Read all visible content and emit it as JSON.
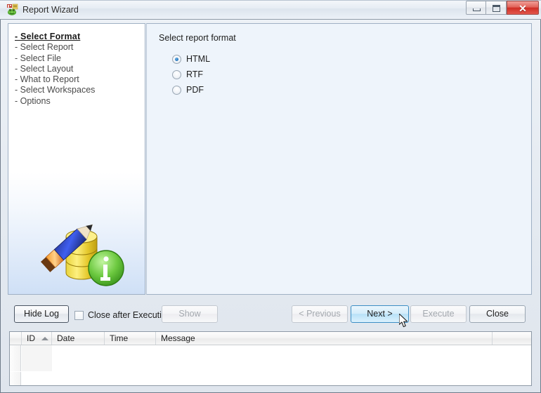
{
  "window": {
    "title": "Report Wizard",
    "icon": "report-wizard-icon",
    "controls": {
      "minimize": "–",
      "maximize": "□",
      "close": "✕"
    }
  },
  "sidebar": {
    "steps": [
      {
        "label": "- Select Format",
        "active": true
      },
      {
        "label": "- Select Report",
        "active": false
      },
      {
        "label": "- Select File",
        "active": false
      },
      {
        "label": "- Select Layout",
        "active": false
      },
      {
        "label": "- What to Report",
        "active": false
      },
      {
        "label": "- Select Workspaces",
        "active": false
      },
      {
        "label": "- Options",
        "active": false
      }
    ],
    "illustration": "pencil-database-info-illustration"
  },
  "content": {
    "title": "Select report format",
    "options": [
      {
        "label": "HTML",
        "selected": true
      },
      {
        "label": "RTF",
        "selected": false
      },
      {
        "label": "PDF",
        "selected": false
      }
    ]
  },
  "toolbar": {
    "hide_log_label": "Hide Log",
    "close_after_execution_label": "Close after Execution",
    "close_after_execution_checked": false,
    "show_label": "Show",
    "show_enabled": false,
    "previous_label": "< Previous",
    "previous_enabled": false,
    "next_label": "Next >",
    "next_enabled": true,
    "execute_label": "Execute",
    "execute_enabled": false,
    "close_label": "Close",
    "close_enabled": true
  },
  "log": {
    "columns": [
      {
        "label": "ID",
        "sorted": "ascending"
      },
      {
        "label": "Date",
        "sorted": ""
      },
      {
        "label": "Time",
        "sorted": ""
      },
      {
        "label": "Message",
        "sorted": ""
      }
    ],
    "rows": []
  },
  "colors": {
    "accent": "#1d6fb8",
    "titlebar": "#e7edf4",
    "close_button": "#cf2f26",
    "content_background": "#eef4fb",
    "hover_button": "#b7e1f8"
  }
}
